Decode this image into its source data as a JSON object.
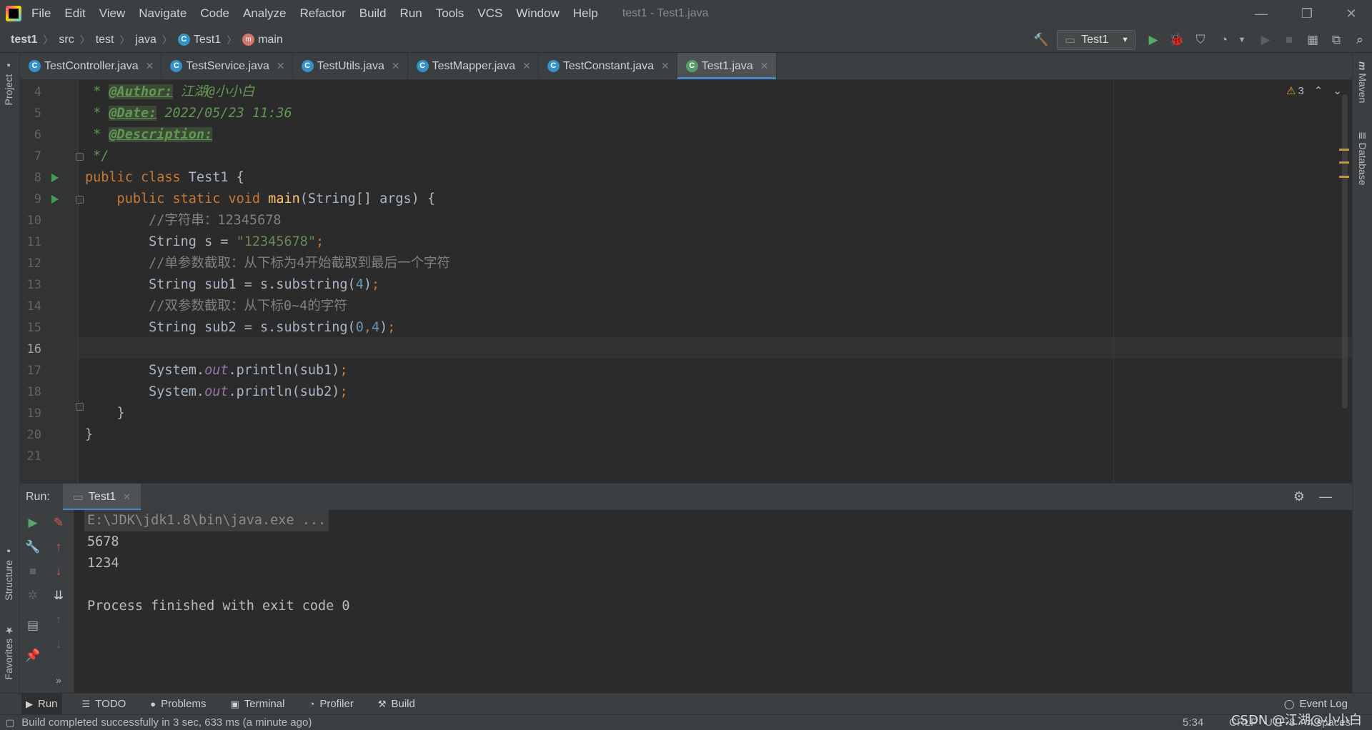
{
  "menubar": {
    "items": [
      "File",
      "Edit",
      "View",
      "Navigate",
      "Code",
      "Analyze",
      "Refactor",
      "Build",
      "Run",
      "Tools",
      "VCS",
      "Window",
      "Help"
    ],
    "window_title": "test1 - Test1.java",
    "minimize": "—",
    "restore": "❐",
    "close": "✕"
  },
  "navbar": {
    "crumbs": [
      "test1",
      "src",
      "test",
      "java",
      "Test1",
      "main"
    ],
    "run_config": "Test1"
  },
  "side": {
    "project": "Project",
    "structure": "Structure",
    "favorites": "Favorites",
    "maven": "Maven",
    "database": "Database"
  },
  "tabs": [
    {
      "label": "TestController.java"
    },
    {
      "label": "TestService.java"
    },
    {
      "label": "TestUtils.java"
    },
    {
      "label": "TestMapper.java"
    },
    {
      "label": "TestConstant.java"
    },
    {
      "label": "Test1.java",
      "active": true
    }
  ],
  "editor": {
    "line_numbers": [
      "4",
      "5",
      "6",
      "7",
      "8",
      "9",
      "10",
      "11",
      "12",
      "13",
      "14",
      "15",
      "16",
      "17",
      "18",
      "19",
      "20",
      "21"
    ],
    "current_line": "16",
    "warnings": "3",
    "code": {
      "l4_a": " * ",
      "l4_tag": "@Author:",
      "l4_b": " 江湖@小小白",
      "l5_a": " * ",
      "l5_tag": "@Date:",
      "l5_b": " 2022/05/23 11:36",
      "l6_a": " * ",
      "l6_tag": "@Description:",
      "l7": " */",
      "l8_kw": "public class",
      "l8_b": " Test1 {",
      "l9_kw": "    public static void",
      "l9_fn": " main",
      "l9_b": "(String[] args) {",
      "l10": "        //字符串：12345678",
      "l11_a": "        String s = ",
      "l11_str": "\"12345678\"",
      "l11_semi": ";",
      "l12": "        //单参数截取：从下标为4开始截取到最后一个字符",
      "l13_a": "        String sub1 = s.substring(",
      "l13_num": "4",
      "l13_b": ")",
      "l13_semi": ";",
      "l14": "        //双参数截取：从下标0~4的字符",
      "l15_a": "        String sub2 = s.substring(",
      "l15_num1": "0",
      "l15_comma": ",",
      "l15_num2": "4",
      "l15_b": ")",
      "l15_semi": ";",
      "l17_a": "        System.",
      "l17_fld": "out",
      "l17_b": ".println(sub1)",
      "l17_semi": ";",
      "l18_a": "        System.",
      "l18_fld": "out",
      "l18_b": ".println(sub2)",
      "l18_semi": ";",
      "l19": "    }",
      "l20": "}"
    }
  },
  "run_panel": {
    "label": "Run:",
    "tab": "Test1",
    "console": [
      "E:\\JDK\\jdk1.8\\bin\\java.exe ...",
      "5678",
      "1234",
      "",
      "Process finished with exit code 0"
    ]
  },
  "tool_tabs": [
    "Run",
    "TODO",
    "Problems",
    "Terminal",
    "Profiler",
    "Build",
    "Event Log"
  ],
  "status": {
    "message": "Build completed successfully in 3 sec, 633 ms (a minute ago)",
    "position": "5:34",
    "line_sep": "CRLF",
    "encoding": "UTF-8",
    "indent": "4 spaces"
  },
  "watermark": "CSDN @江湖@小小白"
}
